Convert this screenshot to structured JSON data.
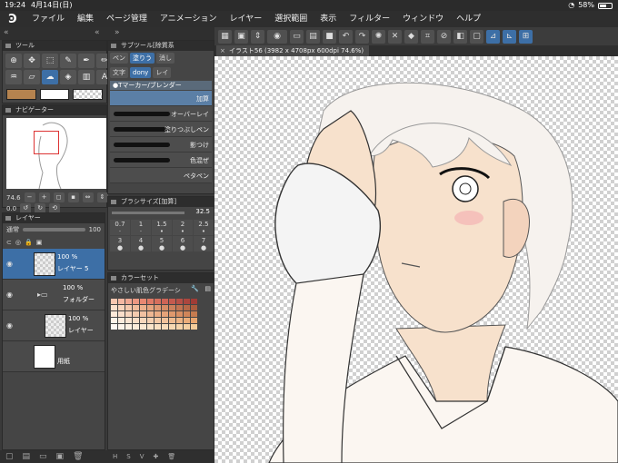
{
  "status": {
    "time": "19:24",
    "date": "4月14日(日)",
    "battery": "58%",
    "battery_level": 0.58
  },
  "menu": [
    "ファイル",
    "編集",
    "ページ管理",
    "アニメーション",
    "レイヤー",
    "選択範囲",
    "表示",
    "フィルター",
    "ウィンドウ",
    "ヘルプ"
  ],
  "panels": {
    "tool": {
      "title": "ツール"
    },
    "subtool": {
      "title": "サブツール[除質系",
      "tabs": [
        "ペン",
        "塗りう",
        "消し",
        "文字",
        "dony",
        "レイ"
      ],
      "header": "●Tマーカー/ブレンダー",
      "brushes": [
        "加算",
        "オーバーレイ",
        "塗りつぶしペン",
        "影つけ",
        "色混ぜ",
        "ペタペン"
      ]
    },
    "navigator": {
      "title": "ナビゲーター",
      "zoom": "74.6",
      "angle": "0.0"
    },
    "brushsize": {
      "title": "ブラシサイズ[加算]",
      "value": "32.5",
      "sizes": [
        "0.7",
        "1",
        "1.5",
        "2",
        "2.5",
        "3",
        "4",
        "5",
        "6",
        "7"
      ]
    },
    "layer": {
      "title": "レイヤー",
      "blend": "通常",
      "opacity": "100",
      "layers": [
        {
          "pct": "100 %",
          "name": "レイヤー 5"
        },
        {
          "pct": "100 %",
          "name": "フォルダー"
        },
        {
          "pct": "100 %",
          "name": "レイヤー"
        },
        {
          "pct": "",
          "name": "用紙"
        }
      ]
    },
    "colorset": {
      "title": "カラーセット",
      "name": "やさしい肌色グラデーシ"
    }
  },
  "document": {
    "tab": "イラスト56 (3982 x 4708px 600dpi 74.6%)"
  },
  "colors": {
    "accent": "#3d6fa6",
    "skin": "#f7e1cc",
    "blush": "#f4b4b4"
  }
}
